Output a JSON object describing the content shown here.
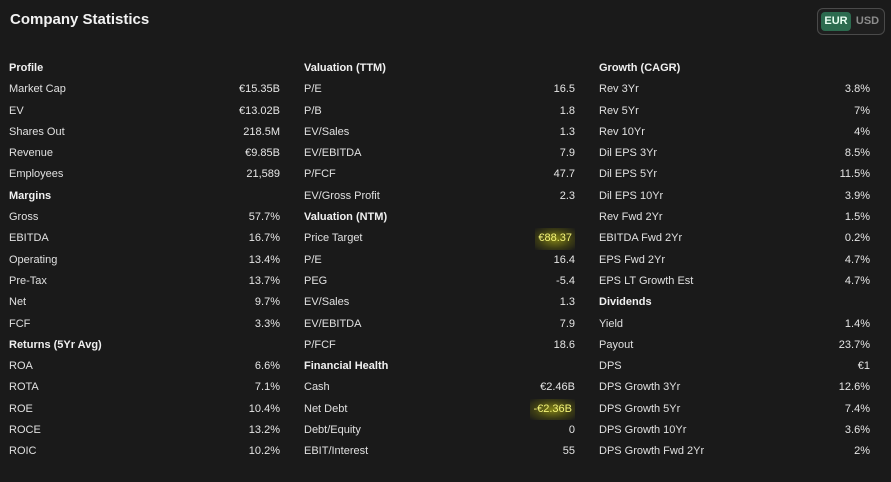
{
  "header": {
    "title": "Company Statistics"
  },
  "currency": {
    "options": [
      "EUR",
      "USD"
    ],
    "selected": "EUR"
  },
  "colors": {
    "background": "#1a1a1a",
    "accent": "#2c6b4f",
    "highlight": "#d6d614"
  },
  "columns": [
    {
      "sections": [
        {
          "title": "Profile",
          "rows": [
            {
              "label": "Market Cap",
              "value": "€15.35B"
            },
            {
              "label": "EV",
              "value": "€13.02B"
            },
            {
              "label": "Shares Out",
              "value": "218.5M"
            },
            {
              "label": "Revenue",
              "value": "€9.85B"
            },
            {
              "label": "Employees",
              "value": "21,589"
            }
          ]
        },
        {
          "title": "Margins",
          "rows": [
            {
              "label": "Gross",
              "value": "57.7%"
            },
            {
              "label": "EBITDA",
              "value": "16.7%"
            },
            {
              "label": "Operating",
              "value": "13.4%"
            },
            {
              "label": "Pre-Tax",
              "value": "13.7%"
            },
            {
              "label": "Net",
              "value": "9.7%"
            },
            {
              "label": "FCF",
              "value": "3.3%"
            }
          ]
        },
        {
          "title": "Returns (5Yr Avg)",
          "rows": [
            {
              "label": "ROA",
              "value": "6.6%"
            },
            {
              "label": "ROTA",
              "value": "7.1%"
            },
            {
              "label": "ROE",
              "value": "10.4%"
            },
            {
              "label": "ROCE",
              "value": "13.2%"
            },
            {
              "label": "ROIC",
              "value": "10.2%"
            }
          ]
        }
      ]
    },
    {
      "sections": [
        {
          "title": "Valuation (TTM)",
          "rows": [
            {
              "label": "P/E",
              "value": "16.5"
            },
            {
              "label": "P/B",
              "value": "1.8"
            },
            {
              "label": "EV/Sales",
              "value": "1.3"
            },
            {
              "label": "EV/EBITDA",
              "value": "7.9"
            },
            {
              "label": "P/FCF",
              "value": "47.7"
            },
            {
              "label": "EV/Gross Profit",
              "value": "2.3"
            }
          ]
        },
        {
          "title": "Valuation (NTM)",
          "rows": [
            {
              "label": "Price Target",
              "value": "€88.37",
              "highlight": true
            },
            {
              "label": "P/E",
              "value": "16.4"
            },
            {
              "label": "PEG",
              "value": "-5.4"
            },
            {
              "label": "EV/Sales",
              "value": "1.3"
            },
            {
              "label": "EV/EBITDA",
              "value": "7.9"
            },
            {
              "label": "P/FCF",
              "value": "18.6"
            }
          ]
        },
        {
          "title": "Financial Health",
          "rows": [
            {
              "label": "Cash",
              "value": "€2.46B"
            },
            {
              "label": "Net Debt",
              "value": "-€2.36B",
              "highlight": true
            },
            {
              "label": "Debt/Equity",
              "value": "0"
            },
            {
              "label": "EBIT/Interest",
              "value": "55"
            }
          ]
        }
      ]
    },
    {
      "sections": [
        {
          "title": "Growth (CAGR)",
          "rows": [
            {
              "label": "Rev 3Yr",
              "value": "3.8%"
            },
            {
              "label": "Rev 5Yr",
              "value": "7%"
            },
            {
              "label": "Rev 10Yr",
              "value": "4%"
            },
            {
              "label": "Dil EPS 3Yr",
              "value": "8.5%"
            },
            {
              "label": "Dil EPS 5Yr",
              "value": "11.5%"
            },
            {
              "label": "Dil EPS 10Yr",
              "value": "3.9%"
            },
            {
              "label": "Rev Fwd 2Yr",
              "value": "1.5%"
            },
            {
              "label": "EBITDA Fwd 2Yr",
              "value": "0.2%"
            },
            {
              "label": "EPS Fwd 2Yr",
              "value": "4.7%"
            },
            {
              "label": "EPS LT Growth Est",
              "value": "4.7%"
            }
          ]
        },
        {
          "title": "Dividends",
          "rows": [
            {
              "label": "Yield",
              "value": "1.4%"
            },
            {
              "label": "Payout",
              "value": "23.7%"
            },
            {
              "label": "DPS",
              "value": "€1"
            },
            {
              "label": "DPS Growth 3Yr",
              "value": "12.6%"
            },
            {
              "label": "DPS Growth 5Yr",
              "value": "7.4%"
            },
            {
              "label": "DPS Growth 10Yr",
              "value": "3.6%"
            },
            {
              "label": "DPS Growth Fwd 2Yr",
              "value": "2%"
            }
          ]
        }
      ]
    }
  ]
}
